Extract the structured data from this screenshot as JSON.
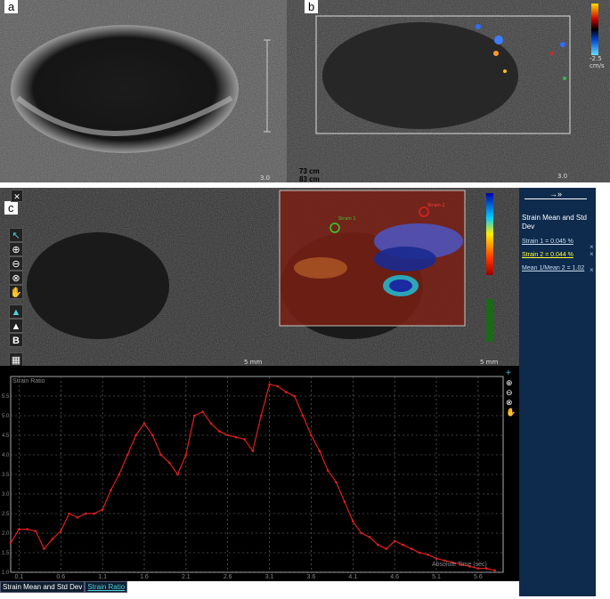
{
  "panels": {
    "a": {
      "label": "a",
      "depth_scale": "3.0"
    },
    "b": {
      "label": "b",
      "colorbar_top": "2.5",
      "colorbar_bottom": "-2.5",
      "colorbar_unit": "cm/s",
      "depth_scale": "3.0"
    },
    "c": {
      "label": "c"
    }
  },
  "readouts": [
    "73 cm",
    "83 cm"
  ],
  "elastography": {
    "scale_left": "5 mm",
    "scale_right": "5 mm",
    "roi_labels": [
      "Strain 1",
      "Strain 2"
    ]
  },
  "tools": [
    "B"
  ],
  "sidebar": {
    "arrow": "→»",
    "title": "Strain Mean and Std Dev",
    "rows": [
      {
        "label": "Strain 1 = 0.045 %",
        "selected": false
      },
      {
        "label": "Strain 2 = 0.044 %",
        "selected": true
      },
      {
        "label": "Mean 1/Mean 2 = 1.02",
        "selected": false
      }
    ],
    "close": "×"
  },
  "tabs": [
    {
      "label": "Strain Mean and Std Dev",
      "active": false
    },
    {
      "label": "Strain Ratio",
      "active": true
    }
  ],
  "colors": {
    "curve": "#e01e1e",
    "accent": "#4dd0e1",
    "sidebar": "#0e2a4d"
  },
  "chart_data": {
    "type": "line",
    "title": "Strain Ratio",
    "xlabel": "Absolute Time (sec)",
    "ylabel": "",
    "xlim": [
      0,
      5.9
    ],
    "ylim": [
      1.0,
      6.0
    ],
    "xticks": [
      "0.1",
      "0.6",
      "1.1",
      "1.6",
      "2.1",
      "2.6",
      "3.1",
      "3.6",
      "4.1",
      "4.6",
      "5.1",
      "5.6"
    ],
    "yticks": [
      "1.0",
      "1.5",
      "2.0",
      "2.5",
      "3.0",
      "3.5",
      "4.0",
      "4.5",
      "5.0",
      "5.5"
    ],
    "grid": true,
    "series": [
      {
        "name": "",
        "x": [
          0.0,
          0.1,
          0.2,
          0.3,
          0.4,
          0.5,
          0.6,
          0.7,
          0.8,
          0.9,
          1.0,
          1.1,
          1.2,
          1.3,
          1.4,
          1.5,
          1.6,
          1.7,
          1.8,
          1.9,
          2.0,
          2.1,
          2.2,
          2.3,
          2.4,
          2.5,
          2.6,
          2.7,
          2.8,
          2.9,
          3.0,
          3.1,
          3.2,
          3.3,
          3.4,
          3.5,
          3.6,
          3.7,
          3.8,
          3.9,
          4.0,
          4.1,
          4.2,
          4.3,
          4.4,
          4.5,
          4.6,
          4.7,
          4.8,
          4.9,
          5.0,
          5.1,
          5.2,
          5.3,
          5.4,
          5.5,
          5.6,
          5.7,
          5.8
        ],
        "y": [
          1.75,
          2.1,
          2.1,
          2.05,
          1.6,
          1.85,
          2.05,
          2.5,
          2.4,
          2.5,
          2.5,
          2.6,
          3.1,
          3.5,
          4.0,
          4.5,
          4.8,
          4.5,
          4.0,
          3.8,
          3.5,
          4.0,
          5.0,
          5.1,
          4.8,
          4.6,
          4.5,
          4.45,
          4.4,
          4.1,
          5.0,
          5.8,
          5.75,
          5.6,
          5.5,
          5.0,
          4.5,
          4.1,
          3.6,
          3.3,
          2.8,
          2.3,
          2.0,
          1.9,
          1.7,
          1.6,
          1.8,
          1.7,
          1.6,
          1.5,
          1.45,
          1.35,
          1.3,
          1.25,
          1.2,
          1.15,
          1.1,
          1.1,
          1.05
        ]
      }
    ]
  }
}
